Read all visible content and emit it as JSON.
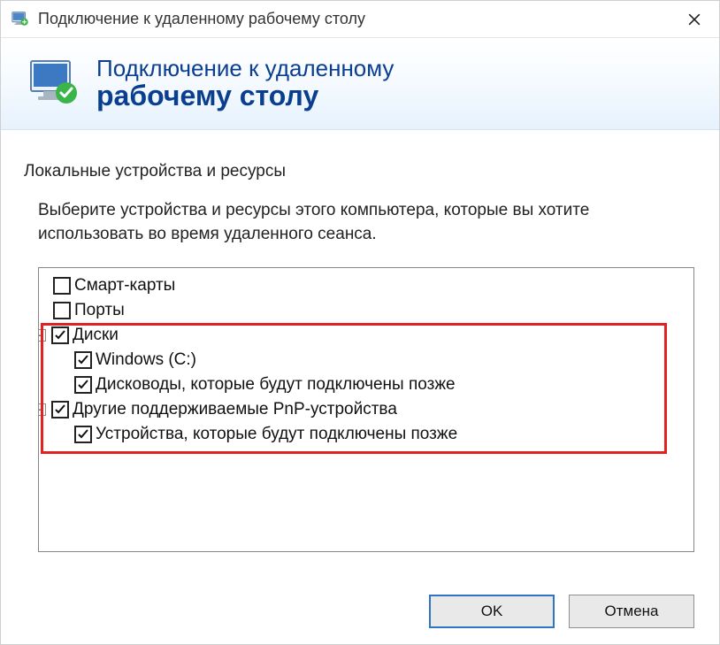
{
  "titlebar": {
    "title": "Подключение к удаленному рабочему столу"
  },
  "header": {
    "line1": "Подключение к удаленному",
    "line2": "рабочему столу"
  },
  "group": {
    "label": "Локальные устройства и ресурсы",
    "description": "Выберите устройства и ресурсы этого компьютера, которые вы хотите использовать во время удаленного сеанса."
  },
  "tree": {
    "items": [
      {
        "label": "Смарт-карты",
        "checked": false,
        "level": 0,
        "expander": null
      },
      {
        "label": "Порты",
        "checked": false,
        "level": 0,
        "expander": null
      },
      {
        "label": "Диски",
        "checked": true,
        "level": 0,
        "expander": "-"
      },
      {
        "label": "Windows (C:)",
        "checked": true,
        "level": 1,
        "expander": null
      },
      {
        "label": "Дисководы, которые будут подключены позже",
        "checked": true,
        "level": 1,
        "expander": null
      },
      {
        "label": "Другие поддерживаемые PnP-устройства",
        "checked": true,
        "level": 0,
        "expander": "-"
      },
      {
        "label": "Устройства, которые будут подключены позже",
        "checked": true,
        "level": 1,
        "expander": null
      }
    ]
  },
  "buttons": {
    "ok": "OK",
    "cancel": "Отмена"
  }
}
